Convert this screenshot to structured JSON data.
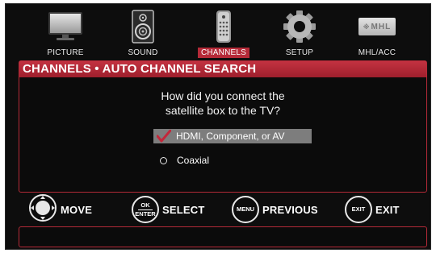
{
  "menu": {
    "items": [
      {
        "label": "PICTURE",
        "icon": "tv-icon"
      },
      {
        "label": "SOUND",
        "icon": "speaker-icon"
      },
      {
        "label": "CHANNELS",
        "icon": "remote-icon",
        "active": true
      },
      {
        "label": "SETUP",
        "icon": "gear-icon"
      },
      {
        "label": "MHL/ACC",
        "icon": "mhl-logo-icon",
        "logo_text": "MHL"
      }
    ]
  },
  "panel": {
    "title": "CHANNELS • AUTO CHANNEL SEARCH",
    "question_line1": "How did you connect the",
    "question_line2": "satellite box to the TV?",
    "options": [
      {
        "label": "HDMI, Component, or AV",
        "selected": true
      },
      {
        "label": "Coaxial",
        "selected": false
      }
    ]
  },
  "controls": {
    "move": {
      "label": "MOVE"
    },
    "select": {
      "label": "SELECT",
      "button_top": "OK",
      "button_bottom": "ENTER"
    },
    "previous": {
      "label": "PREVIOUS",
      "button_text": "MENU"
    },
    "exit": {
      "label": "EXIT",
      "button_text": "EXIT"
    }
  },
  "colors": {
    "accent": "#b52a38",
    "background": "#0d0d0d",
    "selected_row": "#7d7d7d"
  }
}
